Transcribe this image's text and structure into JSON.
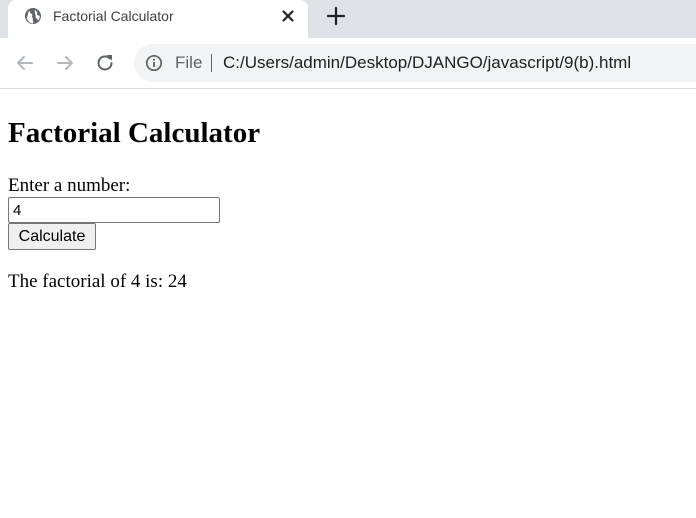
{
  "browser": {
    "tab": {
      "title": "Factorial Calculator",
      "favicon": "globe-icon",
      "close_icon": "close-icon"
    },
    "new_tab_icon": "plus-icon",
    "nav": {
      "back_icon": "back-arrow-icon",
      "forward_icon": "forward-arrow-icon",
      "reload_icon": "reload-icon"
    },
    "address_bar": {
      "info_icon": "info-icon",
      "scheme": "File",
      "url": "C:/Users/admin/Desktop/DJANGO/javascript/9(b).html"
    }
  },
  "page": {
    "title": "Factorial Calculator",
    "prompt_label": "Enter a number:",
    "input_value": "4",
    "button_label": "Calculate",
    "result_text": "The factorial of 4 is: 24"
  }
}
